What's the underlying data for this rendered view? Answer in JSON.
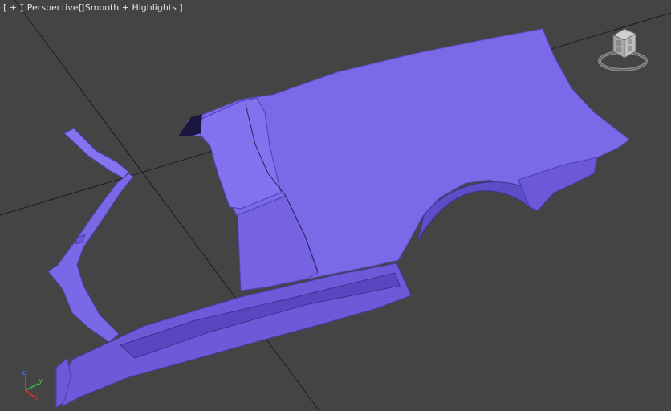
{
  "viewport": {
    "label_plus": "[ + ]",
    "label_view": "[ Perspective ]",
    "label_shading": "[ Smooth + Highlights ]",
    "background_color": "#444444",
    "grid_line_color": "#1c1c1c",
    "model_color": "#7d6bea",
    "model_edge_color": "#2a2160"
  },
  "gizmo": {
    "z_label": "z",
    "y_label": "y",
    "x_label": "x",
    "x_color": "#e03030",
    "y_color": "#3cc43c",
    "z_color": "#4a6aff"
  },
  "viewcube": {
    "icon": "viewcube-icon"
  },
  "object": {
    "type": "car-body-rear-quarter-mesh"
  }
}
